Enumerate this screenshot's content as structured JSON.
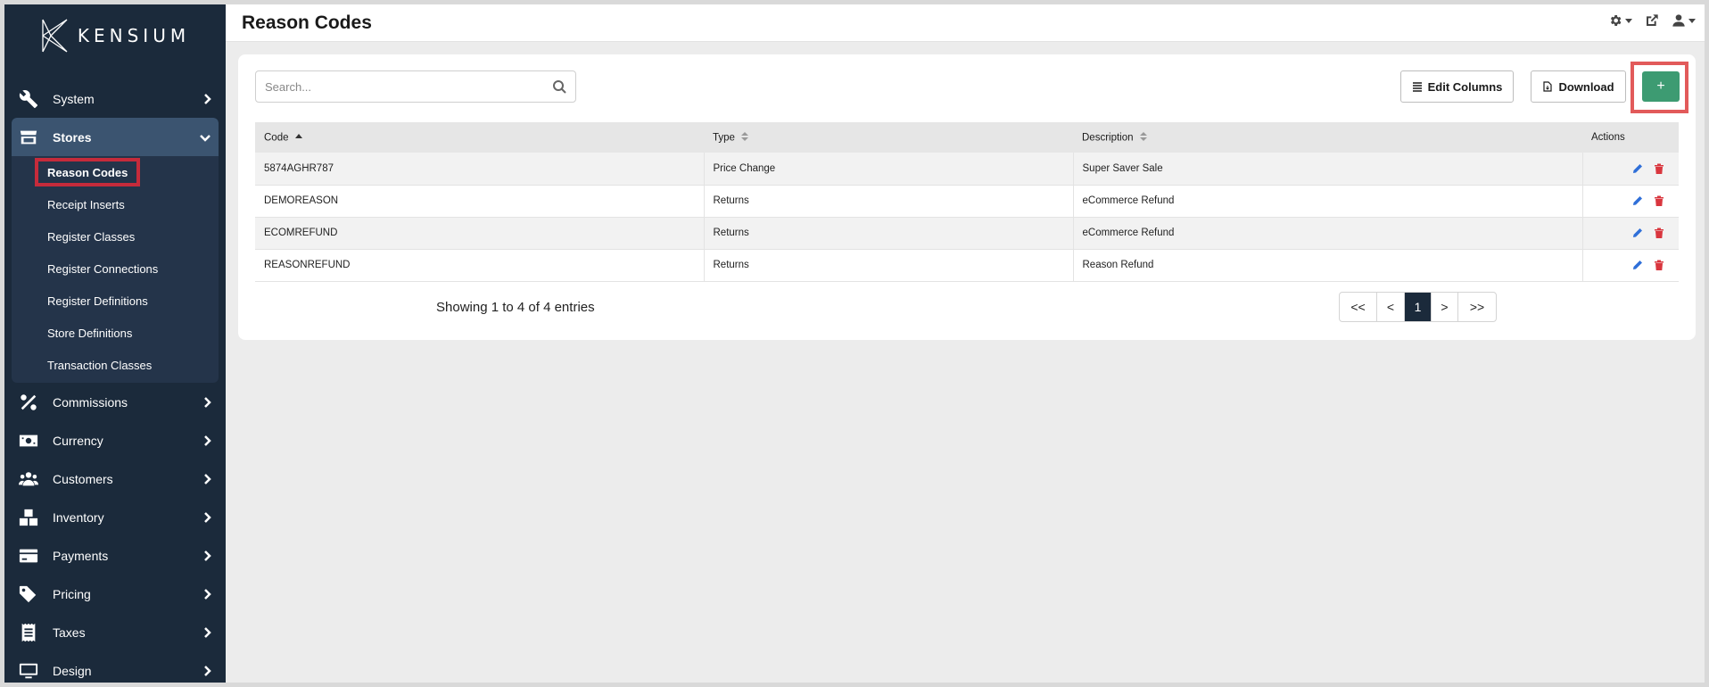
{
  "brand": {
    "logo_text": "KENSIUM"
  },
  "page": {
    "title": "Reason Codes"
  },
  "sidebar": {
    "items_top": [
      {
        "label": "System",
        "icon": "wrench-icon"
      }
    ],
    "stores": {
      "label": "Stores",
      "icon": "store-icon",
      "subitems": [
        "Reason Codes",
        "Receipt Inserts",
        "Register Classes",
        "Register Connections",
        "Register Definitions",
        "Store Definitions",
        "Transaction Classes"
      ],
      "selected": "Reason Codes"
    },
    "items_bottom": [
      {
        "label": "Commissions",
        "icon": "percent-icon"
      },
      {
        "label": "Currency",
        "icon": "money-icon"
      },
      {
        "label": "Customers",
        "icon": "users-icon"
      },
      {
        "label": "Inventory",
        "icon": "boxes-icon"
      },
      {
        "label": "Payments",
        "icon": "credit-card-icon"
      },
      {
        "label": "Pricing",
        "icon": "tags-icon"
      },
      {
        "label": "Taxes",
        "icon": "receipt-icon"
      },
      {
        "label": "Design",
        "icon": "monitor-icon"
      }
    ]
  },
  "toolbar": {
    "search_placeholder": "Search...",
    "edit_columns_label": "Edit Columns",
    "download_label": "Download",
    "add_label": "+"
  },
  "table": {
    "headers": {
      "code": "Code",
      "type": "Type",
      "description": "Description",
      "actions": "Actions"
    },
    "rows": [
      {
        "code": "5874AGHR787",
        "type": "Price Change",
        "description": "Super Saver Sale"
      },
      {
        "code": "DEMOREASON",
        "type": "Returns",
        "description": "eCommerce Refund"
      },
      {
        "code": "ECOMREFUND",
        "type": "Returns",
        "description": "eCommerce Refund"
      },
      {
        "code": "REASONREFUND",
        "type": "Returns",
        "description": "Reason Refund"
      }
    ]
  },
  "pagination": {
    "info": "Showing 1 to 4 of 4 entries",
    "first": "<<",
    "prev": "<",
    "current": "1",
    "next": ">",
    "last": ">>"
  },
  "colors": {
    "sidebar_bg": "#1b2a3b",
    "accent_green": "#3d9b72",
    "highlight_red": "#c62b3b",
    "edit_blue": "#2f6fd8",
    "delete_red": "#d9363e"
  }
}
